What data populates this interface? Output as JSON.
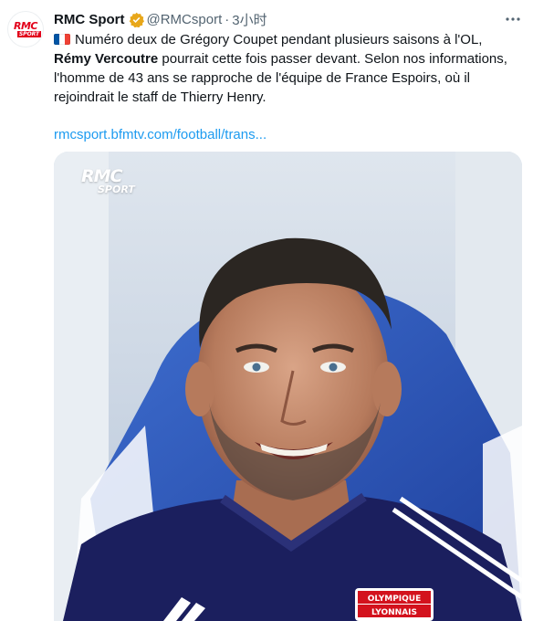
{
  "tweet": {
    "author_name": "RMC Sport",
    "handle": "@RMCsport",
    "separator": "·",
    "time": "3小时",
    "more_icon": "more-horizontal-icon",
    "verified_icon": "verified-badge-icon",
    "text_part1": "Numéro deux de Grégory Coupet pendant plusieurs saisons à l'OL,",
    "text_bold": "Rémy Vercoutre",
    "text_part2": " pourrait cette fois passer devant. Selon nos informations, l'homme de 43 ans se rapproche de l'équipe de France Espoirs, où il rejoindrait le staff de Thierry Henry.",
    "link": "rmcsport.bfmtv.com/football/trans...",
    "flag": "france-flag-icon"
  },
  "avatar": {
    "logo_top": "RMC",
    "logo_bottom": "SPORT"
  },
  "media": {
    "watermark_top": "RMC",
    "watermark_bottom": "SPORT",
    "badge_line1": "OLYMPIQUE",
    "badge_line2": "LYONNAIS"
  },
  "colors": {
    "accent_link": "#1d9bf0",
    "verified": "#e8a71a",
    "brand_red": "#e2001a",
    "jersey_navy": "#1b1f5e"
  }
}
